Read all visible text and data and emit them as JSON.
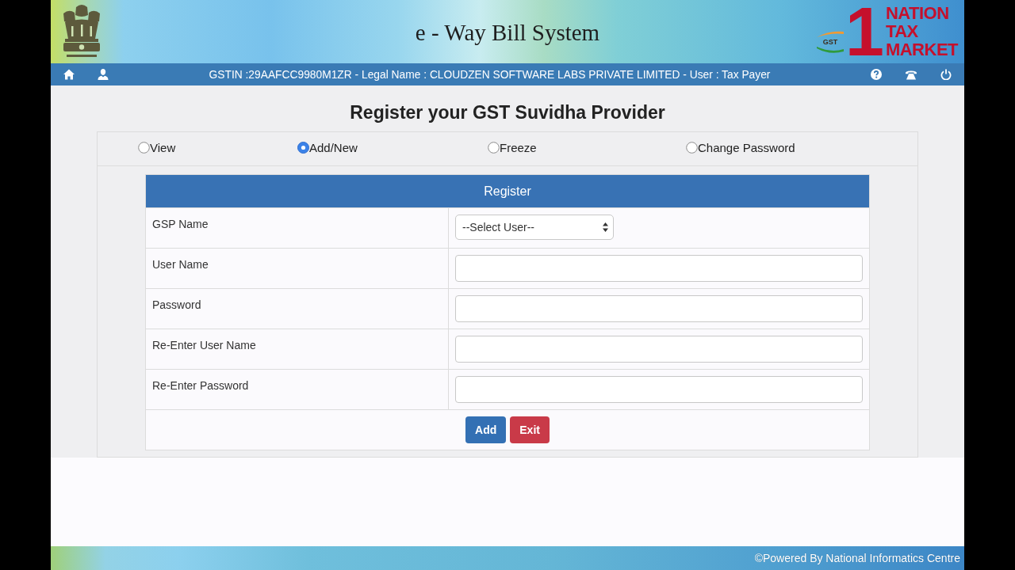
{
  "header": {
    "title": "e - Way Bill System",
    "logo": {
      "numeral": "1",
      "lines": [
        "NATION",
        "TAX",
        "MARKET"
      ],
      "badge": "GST"
    }
  },
  "nav_bar": {
    "info": "GSTIN :29AAFCC9980M1ZR - Legal Name : CLOUDZEN SOFTWARE LABS PRIVATE LIMITED - User : Tax Payer"
  },
  "page_title": "Register your GST Suvidha Provider",
  "options": [
    {
      "label": "View",
      "selected": false
    },
    {
      "label": "Add/New",
      "selected": true
    },
    {
      "label": "Freeze",
      "selected": false
    },
    {
      "label": "Change Password",
      "selected": false
    }
  ],
  "form": {
    "title": "Register",
    "fields": [
      {
        "label": "GSP Name",
        "kind": "select",
        "value": "--Select User--"
      },
      {
        "label": "User Name",
        "kind": "text"
      },
      {
        "label": "Password",
        "kind": "text"
      },
      {
        "label": "Re-Enter User Name",
        "kind": "text"
      },
      {
        "label": "Re-Enter Password",
        "kind": "text"
      }
    ],
    "buttons": [
      {
        "label": "Add",
        "kind": "primary"
      },
      {
        "label": "Exit",
        "kind": "danger"
      }
    ]
  },
  "footer": {
    "text": "©Powered By National Informatics Centre"
  }
}
